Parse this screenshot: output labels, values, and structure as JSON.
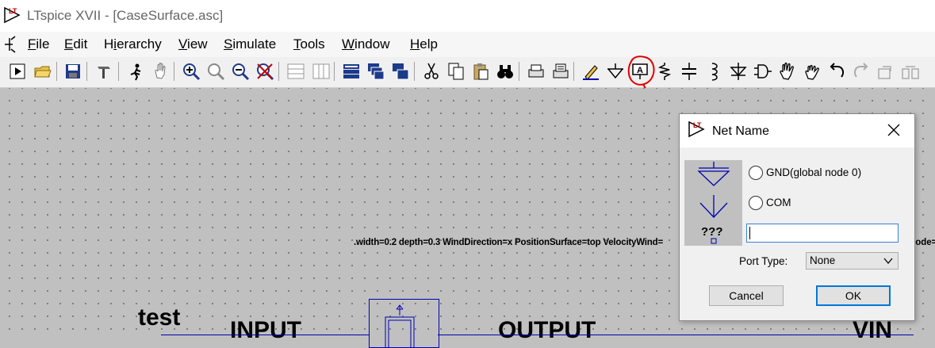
{
  "window": {
    "title": "LTspice XVII - [CaseSurface.asc]"
  },
  "menu": [
    "File",
    "Edit",
    "Hierarchy",
    "View",
    "Simulate",
    "Tools",
    "Window",
    "Help"
  ],
  "menu_underline": [
    "F",
    "E",
    "i",
    "V",
    "S",
    "T",
    "W",
    "H"
  ],
  "toolbar": {
    "icons": [
      "run-icon",
      "open-icon",
      "save-icon",
      "control-panel-icon",
      "halt-icon",
      "pan-icon",
      "zoom-in-icon",
      "zoom-area-icon",
      "zoom-out-icon",
      "zoom-fit-icon",
      "tile-horizontal-icon",
      "tile-vertical-icon",
      "cascade-icon",
      "next-window-icon",
      "window-list-icon",
      "cut-icon",
      "copy-icon",
      "paste-icon",
      "find-icon",
      "print-icon",
      "print-setup-icon",
      "draw-wire-icon",
      "ground-icon",
      "label-net-icon",
      "resistor-icon",
      "capacitor-icon",
      "inductor-icon",
      "diode-icon",
      "component-icon",
      "move-icon",
      "drag-icon",
      "undo-icon",
      "redo-icon",
      "rotate-icon",
      "mirror-icon"
    ]
  },
  "schematic": {
    "directive_text": ".width=0.2 depth=0.3 WindDirection=x PositionSurface=top VelocityWind=",
    "directive_text_tail": "lode=",
    "labels": {
      "test": "test",
      "input": "INPUT",
      "output": "OUTPUT",
      "vin": "VIN"
    }
  },
  "dialog": {
    "title": "Net Name",
    "preview_text": "???",
    "options": [
      "GND(global node 0)",
      "COM"
    ],
    "name_value": "",
    "port_type_label": "Port Type:",
    "port_type_value": "None",
    "cancel_label": "Cancel",
    "ok_label": "OK"
  },
  "colors": {
    "wire": "#0000b0",
    "annotation": "#e00000",
    "canvas": "#c0c0c0"
  }
}
